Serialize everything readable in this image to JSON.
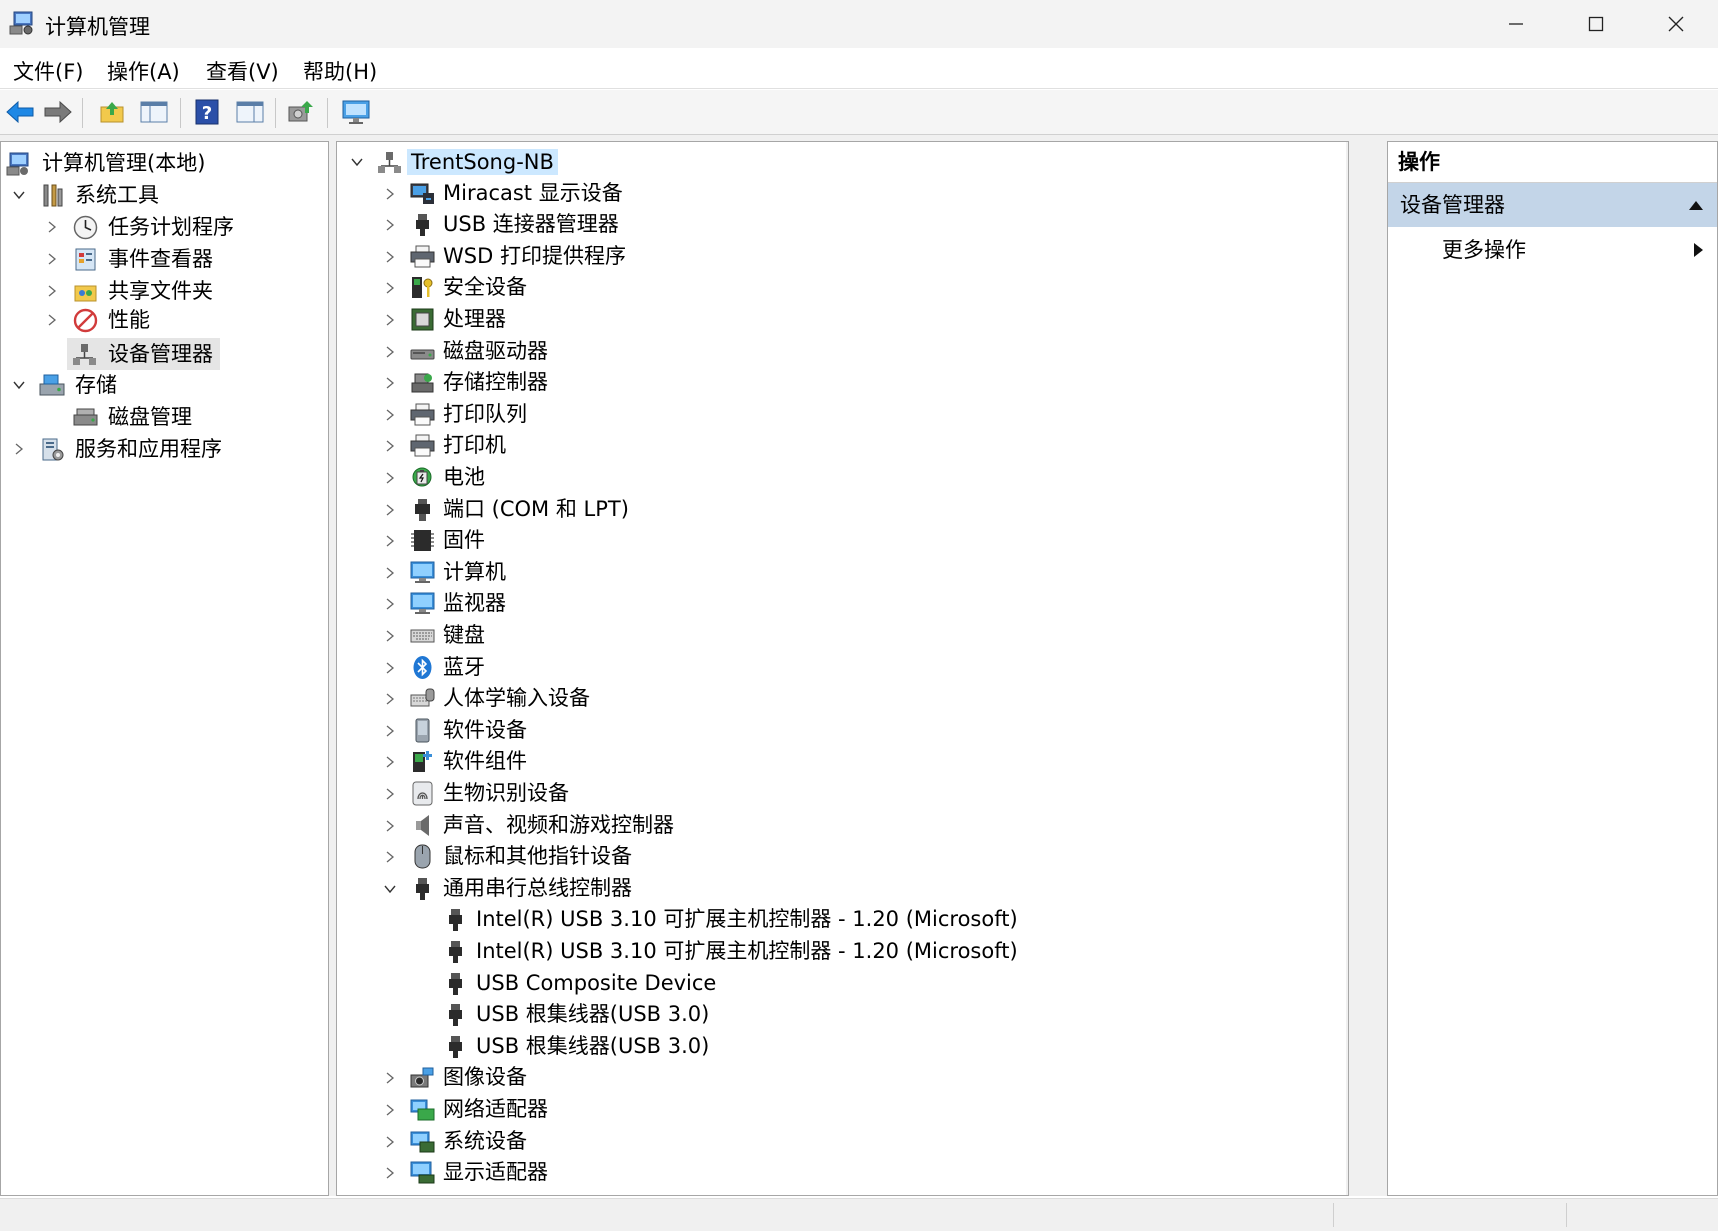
{
  "window": {
    "title": "计算机管理"
  },
  "menu": [
    "文件(F)",
    "操作(A)",
    "查看(V)",
    "帮助(H)"
  ],
  "left_tree": {
    "root": "计算机管理(本地)",
    "system_tools": "系统工具",
    "task_scheduler": "任务计划程序",
    "event_viewer": "事件查看器",
    "shared_folders": "共享文件夹",
    "performance": "性能",
    "device_manager": "设备管理器",
    "storage": "存储",
    "disk_management": "磁盘管理",
    "services_apps": "服务和应用程序"
  },
  "device_tree": {
    "computer": "TrentSong-NB",
    "categories": [
      {
        "label": "Miracast 显示设备",
        "icon": "miracast-icon"
      },
      {
        "label": "USB 连接器管理器",
        "icon": "usb-plug-icon"
      },
      {
        "label": "WSD 打印提供程序",
        "icon": "printer-icon"
      },
      {
        "label": "安全设备",
        "icon": "security-device-icon"
      },
      {
        "label": "处理器",
        "icon": "processor-icon"
      },
      {
        "label": "磁盘驱动器",
        "icon": "disk-drive-icon"
      },
      {
        "label": "存储控制器",
        "icon": "storage-controller-icon"
      },
      {
        "label": "打印队列",
        "icon": "printer-icon"
      },
      {
        "label": "打印机",
        "icon": "printer-icon"
      },
      {
        "label": "电池",
        "icon": "battery-icon"
      },
      {
        "label": "端口 (COM 和 LPT)",
        "icon": "port-icon"
      },
      {
        "label": "固件",
        "icon": "firmware-icon"
      },
      {
        "label": "计算机",
        "icon": "computer-icon"
      },
      {
        "label": "监视器",
        "icon": "monitor-icon"
      },
      {
        "label": "键盘",
        "icon": "keyboard-icon"
      },
      {
        "label": "蓝牙",
        "icon": "bluetooth-icon"
      },
      {
        "label": "人体学输入设备",
        "icon": "hid-icon"
      },
      {
        "label": "软件设备",
        "icon": "software-device-icon"
      },
      {
        "label": "软件组件",
        "icon": "software-component-icon"
      },
      {
        "label": "生物识别设备",
        "icon": "fingerprint-icon"
      },
      {
        "label": "声音、视频和游戏控制器",
        "icon": "speaker-icon"
      },
      {
        "label": "鼠标和其他指针设备",
        "icon": "mouse-icon"
      },
      {
        "label": "通用串行总线控制器",
        "icon": "usb-plug-icon",
        "expanded": true
      }
    ],
    "usb_children": [
      "Intel(R) USB 3.10 可扩展主机控制器 - 1.20 (Microsoft)",
      "Intel(R) USB 3.10 可扩展主机控制器 - 1.20 (Microsoft)",
      "USB Composite Device",
      "USB 根集线器(USB 3.0)",
      "USB 根集线器(USB 3.0)"
    ],
    "after": [
      {
        "label": "图像设备",
        "icon": "camera-icon"
      },
      {
        "label": "网络适配器",
        "icon": "network-adapter-icon"
      },
      {
        "label": "系统设备",
        "icon": "system-device-icon"
      },
      {
        "label": "显示适配器",
        "icon": "display-adapter-icon"
      }
    ]
  },
  "actions": {
    "header": "操作",
    "section": "设备管理器",
    "more": "更多操作"
  },
  "colors": {
    "selected_bg": "#e5e5e5",
    "computer_bg": "#cce8ff",
    "actions_section_bg": "#c3d5e8",
    "highlight_red": "#e52222"
  }
}
